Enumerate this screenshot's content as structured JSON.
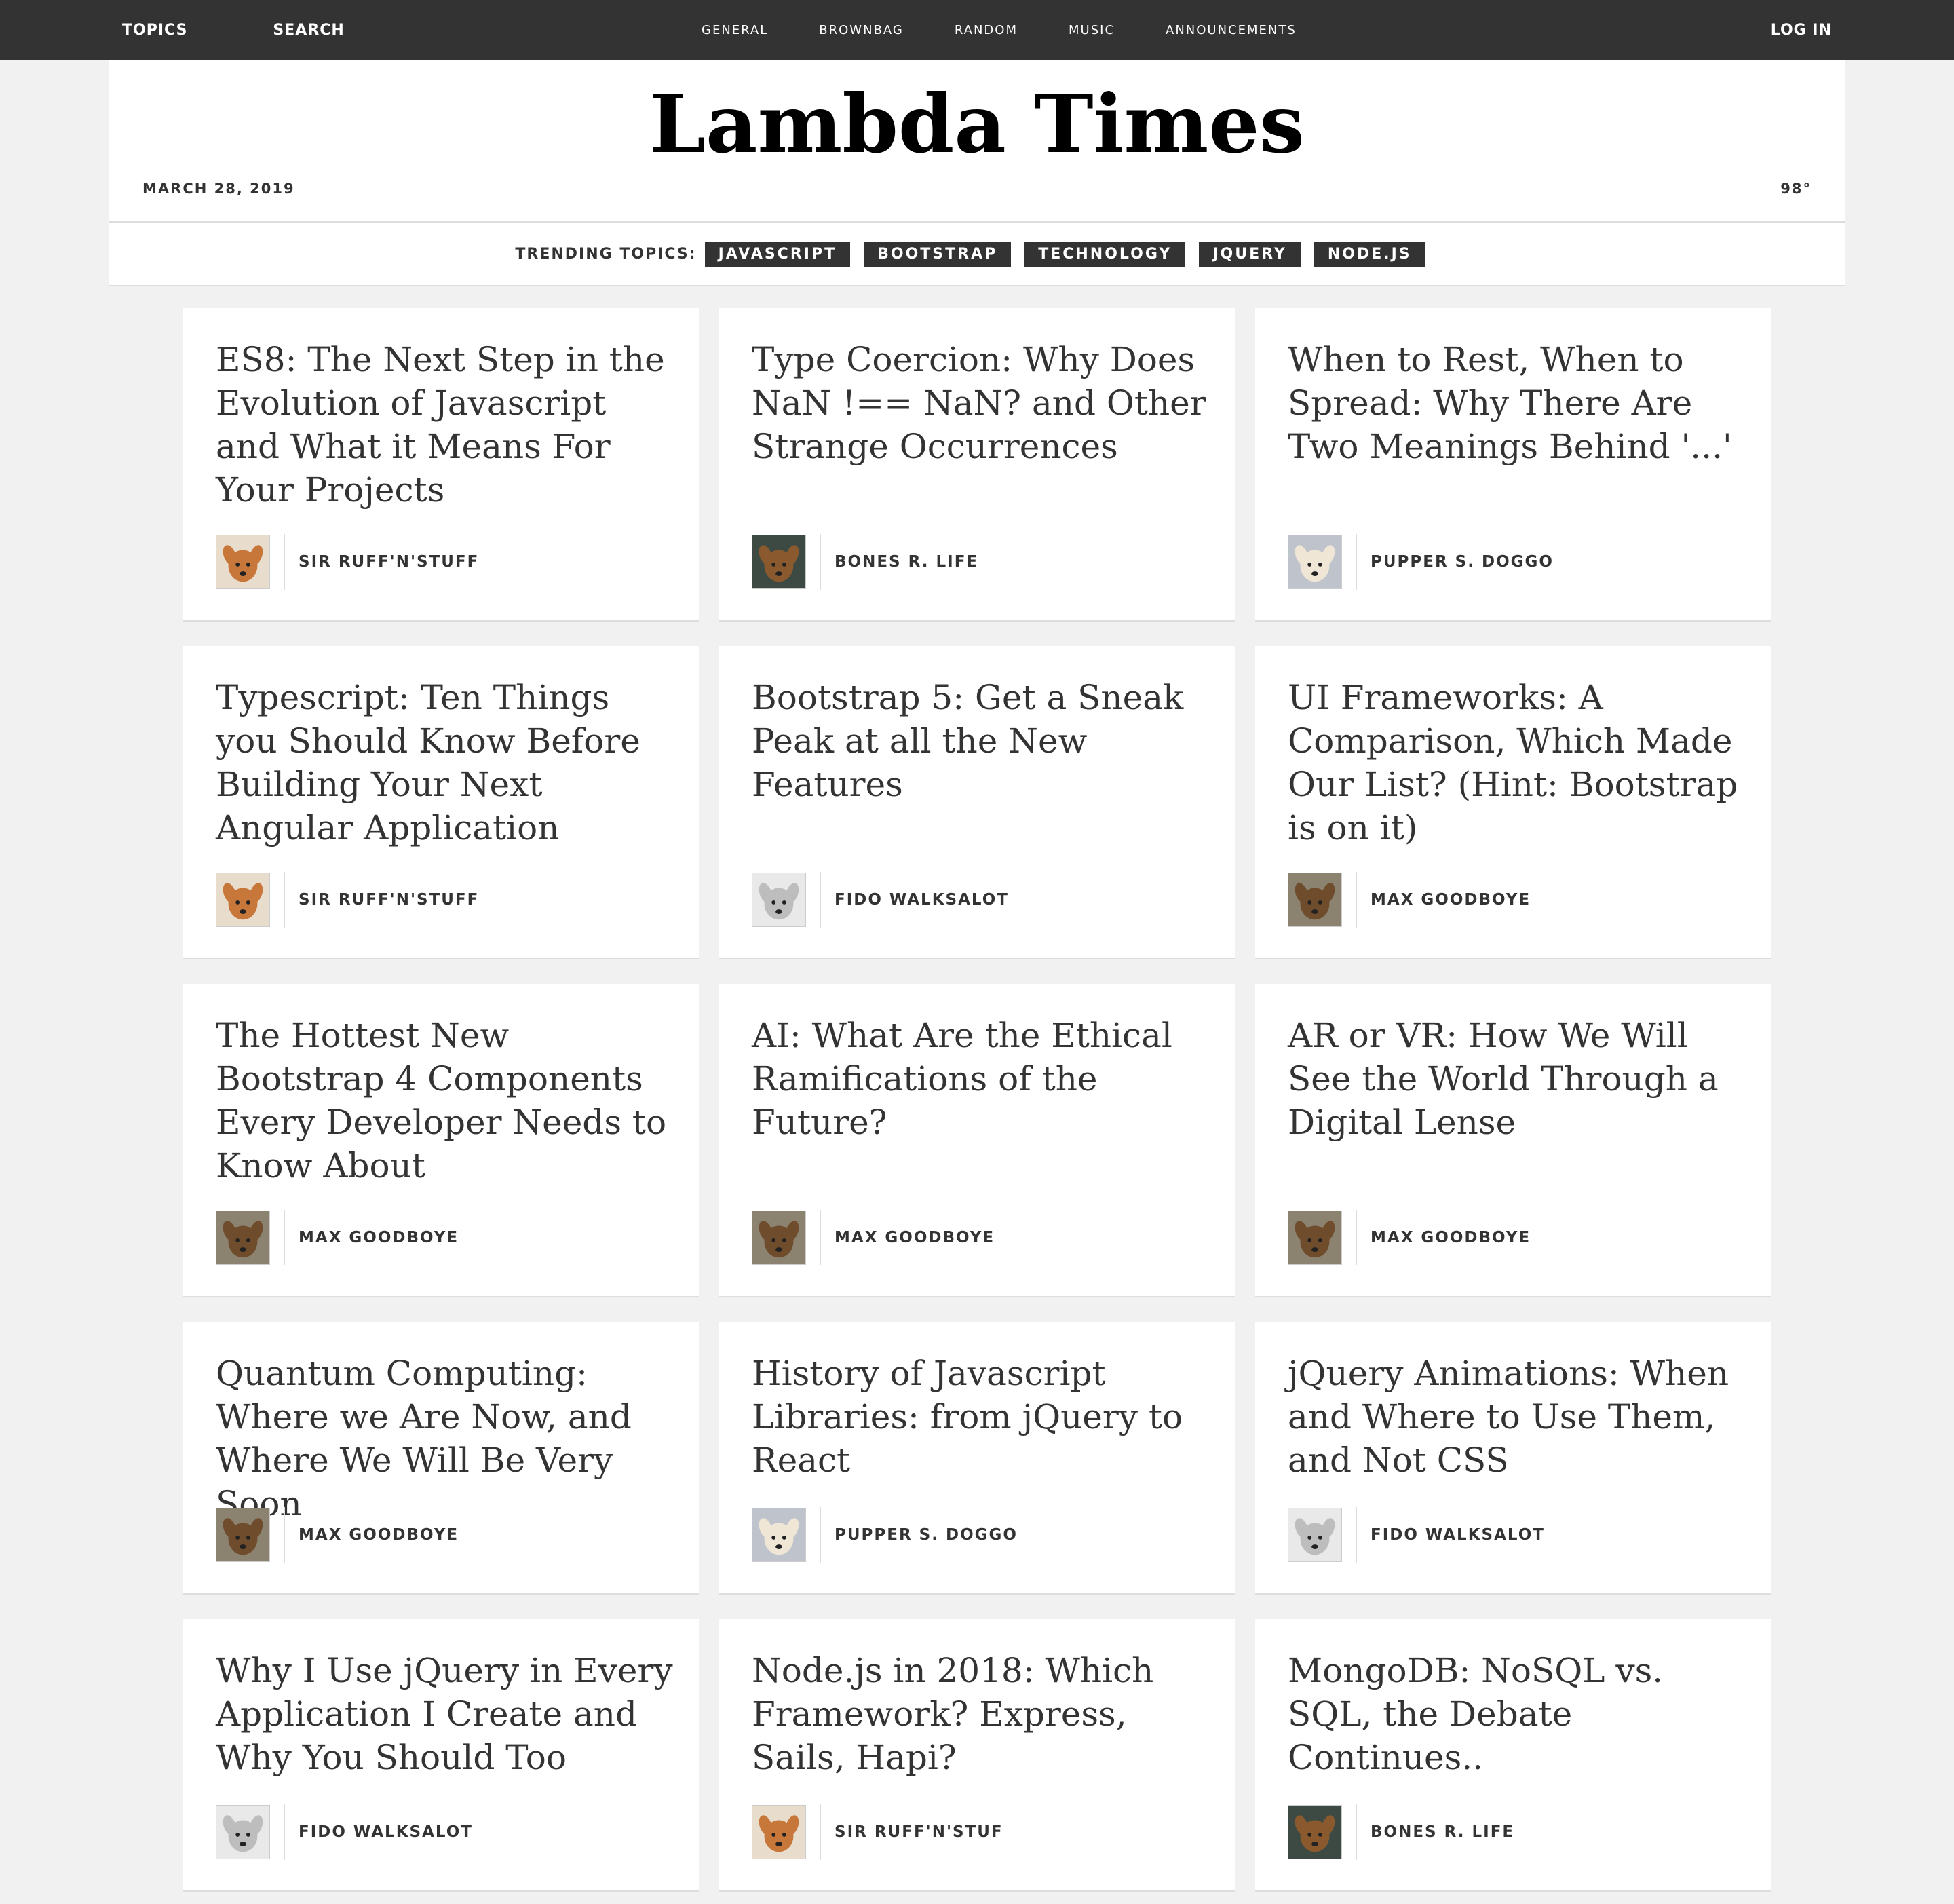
{
  "topbar": {
    "topics": "TOPICS",
    "search": "SEARCH",
    "nav": [
      "GENERAL",
      "BROWNBAG",
      "RANDOM",
      "MUSIC",
      "ANNOUNCEMENTS"
    ],
    "login": "LOG IN"
  },
  "header": {
    "title": "Lambda Times",
    "date": "MARCH 28, 2019",
    "temp": "98°"
  },
  "trending": {
    "label": "TRENDING TOPICS:",
    "tags": [
      "JAVASCRIPT",
      "BOOTSTRAP",
      "TECHNOLOGY",
      "JQUERY",
      "NODE.JS"
    ]
  },
  "colors": {
    "topbar_bg": "#333333",
    "page_bg": "#f1f1f1",
    "card_bg": "#ffffff",
    "tag_bg": "#333333"
  },
  "cards": [
    {
      "headline": "ES8: The Next Step in the Evolution of Javascript and What it Means For Your Projects",
      "author": "SIR RUFF'N'STUFF",
      "avatar": "orange-dog-icon"
    },
    {
      "headline": "Type Coercion: Why Does NaN !== NaN? and Other Strange Occurrences",
      "author": "BONES R. LIFE",
      "avatar": "brown-dog-icon"
    },
    {
      "headline": "When to Rest, When to Spread: Why There Are Two Meanings Behind '...'",
      "author": "PUPPER S. DOGGO",
      "avatar": "puppy-icon"
    },
    {
      "headline": "Typescript: Ten Things you Should Know Before Building Your Next Angular Application",
      "author": "SIR RUFF'N'STUFF",
      "avatar": "orange-dog-icon"
    },
    {
      "headline": "Bootstrap 5: Get a Sneak Peak at all the New Features",
      "author": "FIDO WALKSALOT",
      "avatar": "white-dog-icon"
    },
    {
      "headline": "UI Frameworks: A Comparison, Which Made Our List? (Hint: Bootstrap is on it)",
      "author": "MAX GOODBOYE",
      "avatar": "goggles-dog-icon"
    },
    {
      "headline": "The Hottest New Bootstrap 4 Components Every Developer Needs to Know About",
      "author": "MAX GOODBOYE",
      "avatar": "goggles-dog-icon"
    },
    {
      "headline": "AI: What Are the Ethical Ramifications of the Future?",
      "author": "MAX GOODBOYE",
      "avatar": "goggles-dog-icon"
    },
    {
      "headline": "AR or VR: How We Will See the World Through a Digital Lense",
      "author": "MAX GOODBOYE",
      "avatar": "goggles-dog-icon"
    },
    {
      "headline": "Quantum Computing: Where we Are Now, and Where We Will Be Very Soon",
      "author": "MAX GOODBOYE",
      "avatar": "goggles-dog-icon"
    },
    {
      "headline": "History of Javascript Libraries: from jQuery to React",
      "author": "PUPPER S. DOGGO",
      "avatar": "puppy-icon"
    },
    {
      "headline": "jQuery Animations: When and Where to Use Them, and Not CSS",
      "author": "FIDO WALKSALOT",
      "avatar": "white-dog-icon"
    },
    {
      "headline": "Why I Use jQuery in Every Application I Create and Why You Should Too",
      "author": "FIDO WALKSALOT",
      "avatar": "white-dog-icon"
    },
    {
      "headline": "Node.js in 2018: Which Framework? Express, Sails, Hapi?",
      "author": "SIR RUFF'N'STUF",
      "avatar": "orange-dog-icon"
    },
    {
      "headline": "MongoDB: NoSQL vs. SQL, the Debate Continues..",
      "author": "BONES R. LIFE",
      "avatar": "brown-dog-icon"
    }
  ]
}
